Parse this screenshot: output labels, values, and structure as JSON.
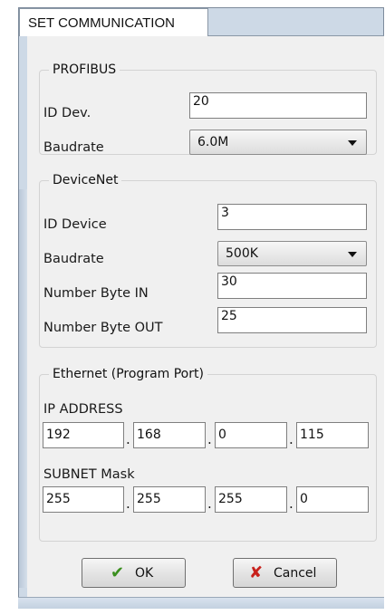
{
  "window": {
    "tab_title": "SET COMMUNICATION"
  },
  "profibus": {
    "title": "PROFIBUS",
    "id_label": "ID Dev.",
    "id_value": "20",
    "baud_label": "Baudrate",
    "baud_value": "6.0M"
  },
  "devicenet": {
    "title": "DeviceNet",
    "id_label": "ID Device",
    "id_value": "3",
    "baud_label": "Baudrate",
    "baud_value": "500K",
    "byte_in_label": "Number Byte IN",
    "byte_in_value": "30",
    "byte_out_label": "Number Byte OUT",
    "byte_out_value": "25"
  },
  "ethernet": {
    "title": "Ethernet (Program Port)",
    "ip_label": "IP ADDRESS",
    "ip": [
      "192",
      "168",
      "0",
      "115"
    ],
    "mask_label": "SUBNET Mask",
    "mask": [
      "255",
      "255",
      "255",
      "0"
    ],
    "separator": "."
  },
  "buttons": {
    "ok_label": "OK",
    "ok_icon": "checkmark-icon",
    "ok_icon_color": "#3a8f1e",
    "cancel_label": "Cancel",
    "cancel_icon": "x-icon",
    "cancel_icon_color": "#c8201b"
  }
}
